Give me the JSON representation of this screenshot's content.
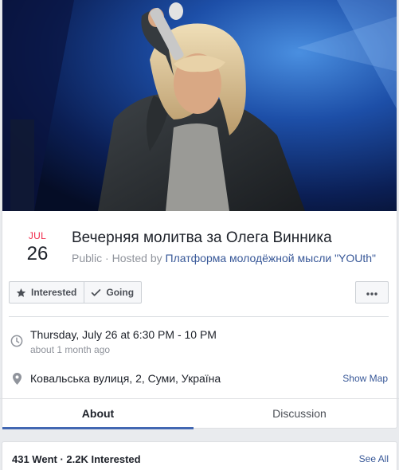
{
  "event": {
    "date": {
      "month": "JUL",
      "day": "26"
    },
    "title": "Вечерняя молитва за Олега Винника",
    "privacy": "Public",
    "hosted_prefix": "Hosted by",
    "host": "Платформа молодёжной мысли \"YOUth\""
  },
  "actions": {
    "interested_label": "Interested",
    "going_label": "Going",
    "more_icon": "ellipsis-icon"
  },
  "details": {
    "time": "Thursday, July 26 at 6:30 PM - 10 PM",
    "time_sub": "about 1 month ago",
    "location": "Ковальська вулиця, 2, Суми, Україна",
    "show_map_label": "Show Map"
  },
  "tabs": [
    {
      "label": "About",
      "active": true
    },
    {
      "label": "Discussion",
      "active": false
    }
  ],
  "guests": {
    "summary": "431 Went · 2.2K Interested",
    "see_all_label": "See All"
  },
  "colors": {
    "accent": "#4267b2",
    "link": "#385898",
    "month": "#f02849"
  }
}
